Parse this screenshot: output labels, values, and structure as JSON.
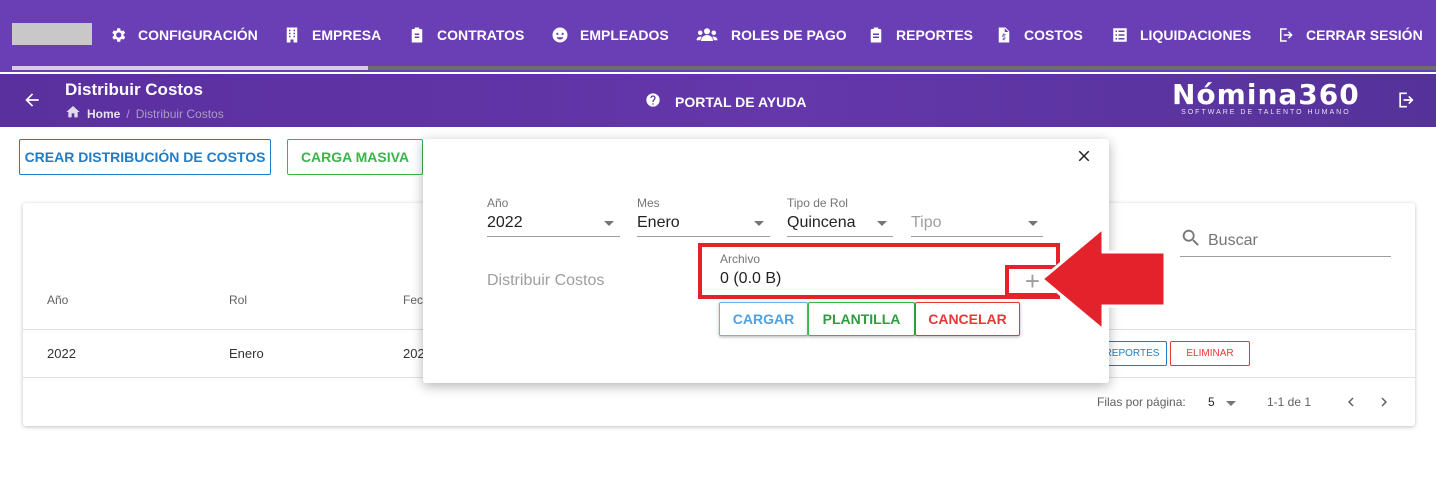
{
  "nav": {
    "items": [
      {
        "label": "CONFIGURACIÓN",
        "icon": "gear-icon"
      },
      {
        "label": "EMPRESA",
        "icon": "building-icon"
      },
      {
        "label": "CONTRATOS",
        "icon": "clipboard-icon"
      },
      {
        "label": "EMPLEADOS",
        "icon": "face-icon"
      },
      {
        "label": "ROLES DE PAGO",
        "icon": "users-icon"
      },
      {
        "label": "REPORTES",
        "icon": "clipboard-list-icon"
      },
      {
        "label": "COSTOS",
        "icon": "file-dollar-icon"
      },
      {
        "label": "LIQUIDACIONES",
        "icon": "list-icon"
      },
      {
        "label": "CERRAR SESIÓN",
        "icon": "logout-icon"
      }
    ],
    "progress": 0.25,
    "color": "#6a3eb5"
  },
  "header": {
    "title": "Distribuir Costos",
    "breadcrumb_home": "Home",
    "breadcrumb_sep": "/",
    "breadcrumb_current": "Distribuir Costos",
    "help": "PORTAL DE AYUDA",
    "brand_name": "Nómina360",
    "brand_tagline": "SOFTWARE DE TALENTO HUMANO"
  },
  "actions": {
    "crear": "CREAR DISTRIBUCIÓN DE COSTOS",
    "carga": "CARGA MASIVA"
  },
  "table": {
    "search_placeholder": "Buscar",
    "headers": {
      "anio": "Año",
      "rol": "Rol",
      "fecha": "Fec"
    },
    "row": {
      "anio": "2022",
      "rol": "Enero",
      "fecha": "202",
      "reportes": "REPORTES",
      "eliminar": "ELIMINAR"
    },
    "rows_per_page_label": "Filas por página:",
    "rows_per_page": "5",
    "range": "1-1 de 1"
  },
  "modal": {
    "anio_label": "Año",
    "anio_value": "2022",
    "mes_label": "Mes",
    "mes_value": "Enero",
    "tipo_rol_label": "Tipo de Rol",
    "tipo_rol_value": "Quincena",
    "tipo_placeholder": "Tipo",
    "dist_label": "Distribuir Costos",
    "archivo_label": "Archivo",
    "archivo_value": "0 (0.0 B)",
    "plus": "+",
    "cargar": "CARGAR",
    "plantilla": "PLANTILLA",
    "cancelar": "CANCELAR"
  },
  "colors": {
    "annotation_red": "#e4222b",
    "blue": "#1f7dc7",
    "green": "#3ab54a",
    "red": "#e53935"
  }
}
